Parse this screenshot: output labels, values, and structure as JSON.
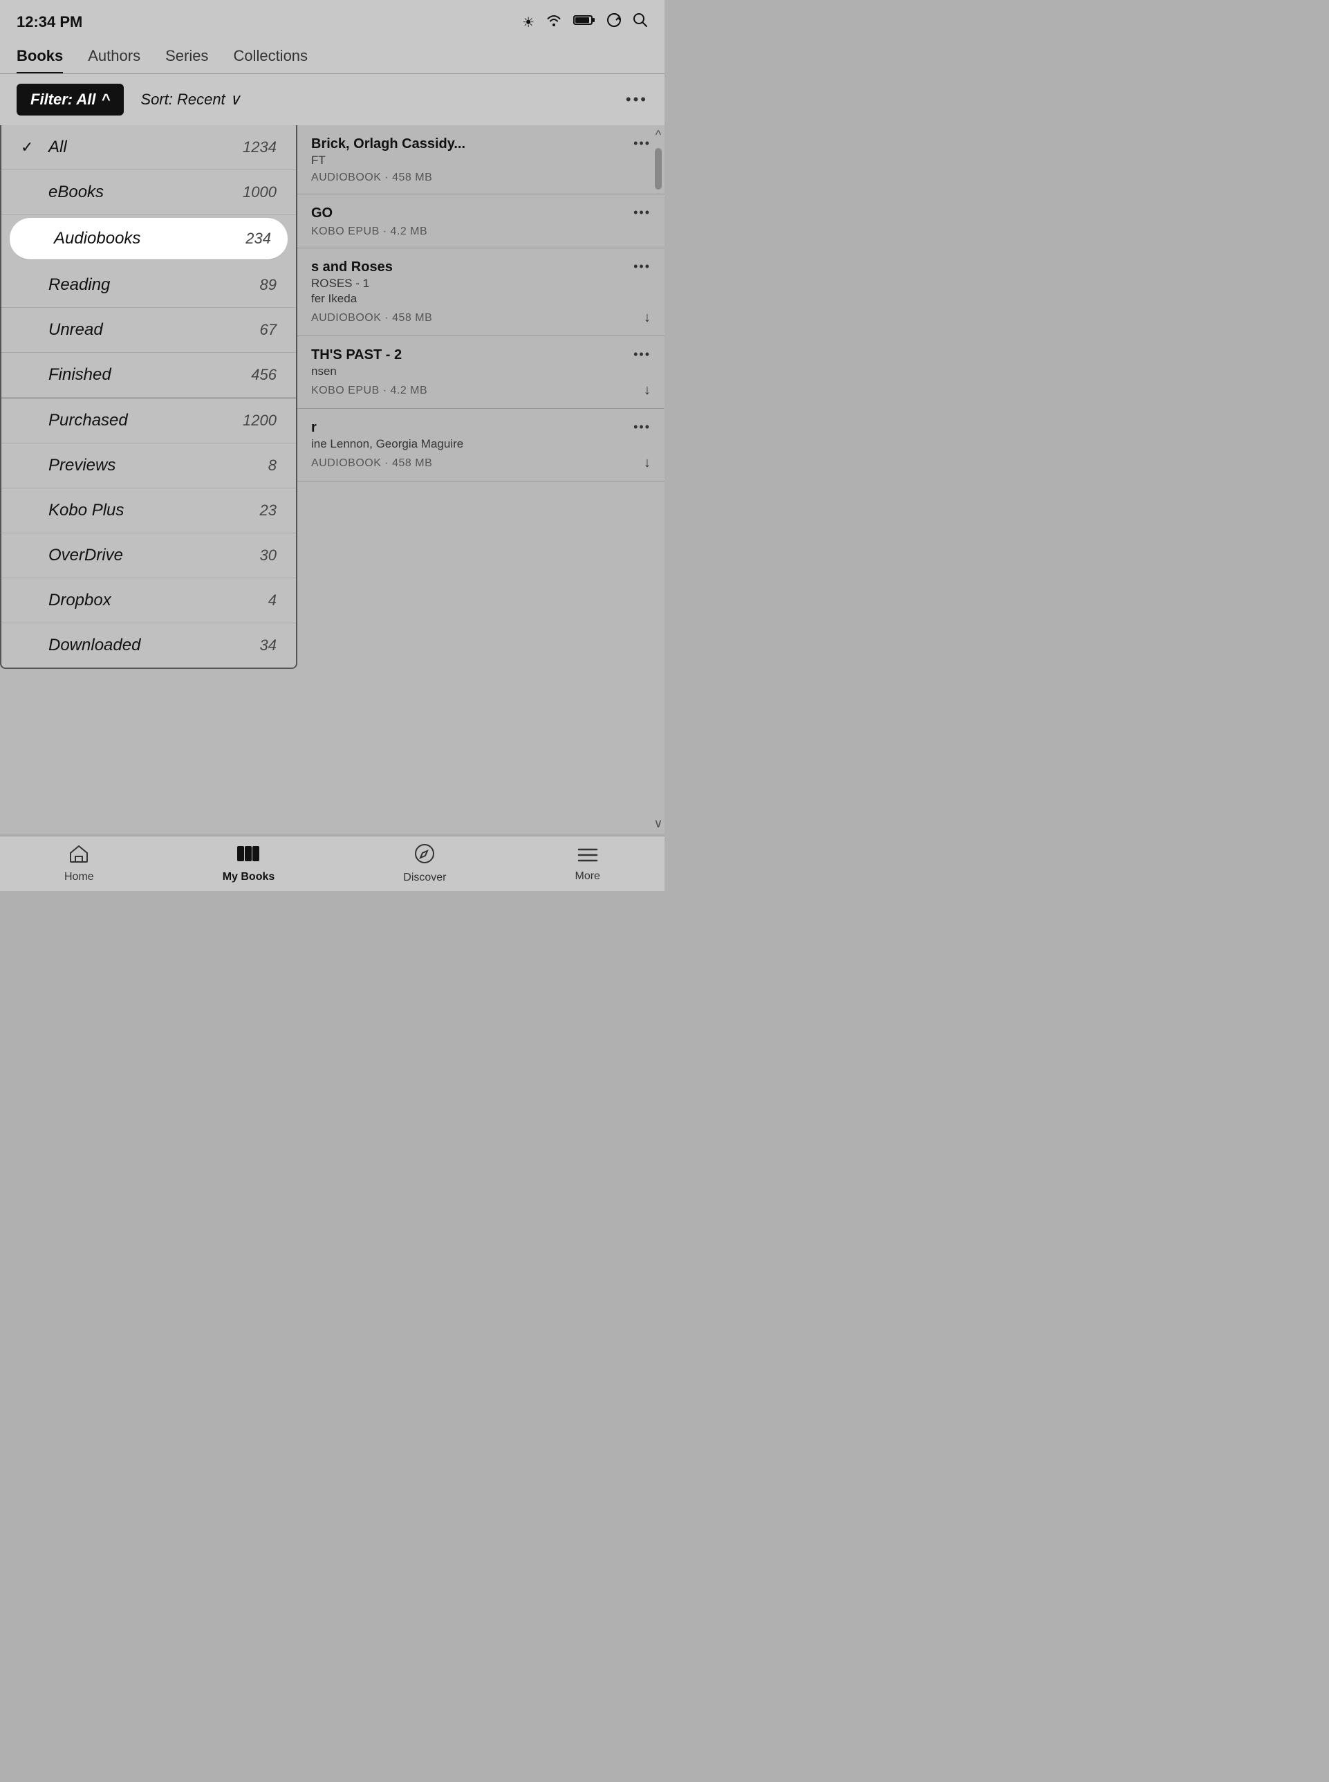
{
  "statusBar": {
    "time": "12:34 PM"
  },
  "tabs": [
    {
      "id": "books",
      "label": "Books",
      "active": true
    },
    {
      "id": "authors",
      "label": "Authors",
      "active": false
    },
    {
      "id": "series",
      "label": "Series",
      "active": false
    },
    {
      "id": "collections",
      "label": "Collections",
      "active": false
    }
  ],
  "filterBar": {
    "filterLabel": "Filter: All",
    "filterChevron": "^",
    "sortLabel": "Sort: Recent",
    "sortChevron": "∨",
    "moreDots": "•••"
  },
  "dropdown": {
    "items": [
      {
        "id": "all",
        "label": "All",
        "count": "1234",
        "checked": true,
        "selected": false
      },
      {
        "id": "ebooks",
        "label": "eBooks",
        "count": "1000",
        "checked": false,
        "selected": false
      },
      {
        "id": "audiobooks",
        "label": "Audiobooks",
        "count": "234",
        "checked": false,
        "selected": true
      },
      {
        "id": "reading",
        "label": "Reading",
        "count": "89",
        "checked": false,
        "selected": false
      },
      {
        "id": "unread",
        "label": "Unread",
        "count": "67",
        "checked": false,
        "selected": false
      },
      {
        "id": "finished",
        "label": "Finished",
        "count": "456",
        "checked": false,
        "selected": false
      },
      {
        "id": "purchased",
        "label": "Purchased",
        "count": "1200",
        "checked": false,
        "selected": false
      },
      {
        "id": "previews",
        "label": "Previews",
        "count": "8",
        "checked": false,
        "selected": false
      },
      {
        "id": "koboplus",
        "label": "Kobo Plus",
        "count": "23",
        "checked": false,
        "selected": false
      },
      {
        "id": "overdrive",
        "label": "OverDrive",
        "count": "30",
        "checked": false,
        "selected": false
      },
      {
        "id": "dropbox",
        "label": "Dropbox",
        "count": "4",
        "checked": false,
        "selected": false
      },
      {
        "id": "downloaded",
        "label": "Downloaded",
        "count": "34",
        "checked": false,
        "selected": false
      }
    ]
  },
  "bookList": {
    "moreDots": "•••",
    "books": [
      {
        "id": "book1",
        "titleVisible": "Brick, Orlagh Cassidy...",
        "subtitle": "FT",
        "meta": "AUDIOBOOK · 458 MB",
        "hasDownload": false,
        "hasDots": true
      },
      {
        "id": "book2",
        "titleVisible": "GO",
        "subtitle": "",
        "meta": "KOBO EPUB · 4.2 MB",
        "hasDownload": false,
        "hasDots": true
      },
      {
        "id": "book3",
        "titleVisible": "s and Roses",
        "subtitle": "ROSES - 1\nfer Ikeda",
        "meta": "AUDIOBOOK · 458 MB",
        "hasDownload": true,
        "hasDots": true
      },
      {
        "id": "book4",
        "titleVisible": "TH'S PAST - 2",
        "subtitle": "nsen",
        "meta": "KOBO EPUB · 4.2 MB",
        "hasDownload": true,
        "hasDots": true
      },
      {
        "id": "book5",
        "titleVisible": "r",
        "subtitle": "ine Lennon, Georgia Maguire",
        "meta": "AUDIOBOOK · 458 MB",
        "hasDownload": true,
        "hasDots": true
      }
    ]
  },
  "bottomNav": [
    {
      "id": "home",
      "icon": "home",
      "label": "Home",
      "bold": false
    },
    {
      "id": "mybooks",
      "icon": "books",
      "label": "My Books",
      "bold": true
    },
    {
      "id": "discover",
      "icon": "compass",
      "label": "Discover",
      "bold": false
    },
    {
      "id": "more",
      "icon": "menu",
      "label": "More",
      "bold": false
    }
  ]
}
